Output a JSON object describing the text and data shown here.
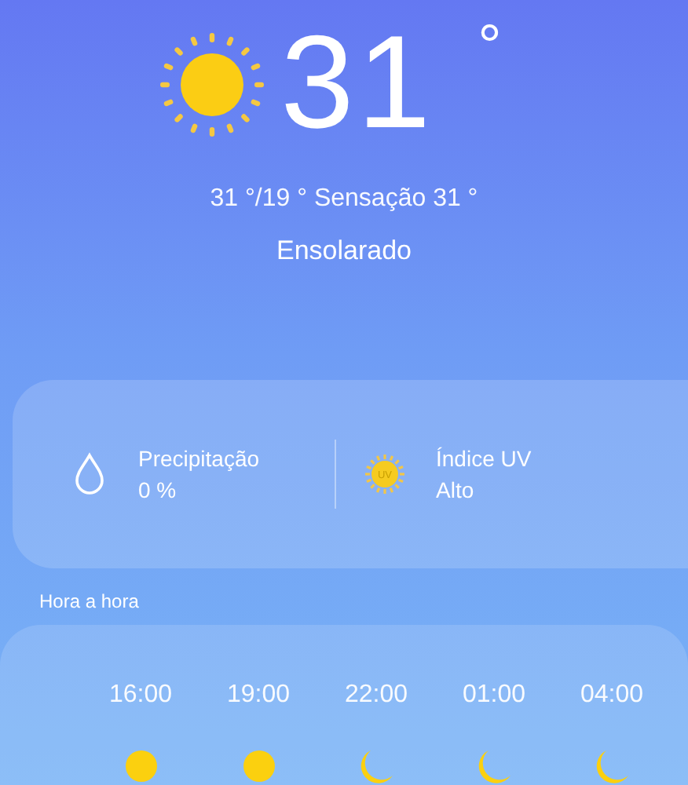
{
  "current": {
    "temperature": "31",
    "degree": "°",
    "range": "31 °/19 ° Sensação 31 °",
    "condition": "Ensolarado"
  },
  "details": [
    {
      "kind": "drop",
      "label": "Precipitação",
      "value": "0 %"
    },
    {
      "kind": "uv",
      "label": "Índice UV",
      "value": "Alto",
      "badge": "UV"
    }
  ],
  "hourly": {
    "title": "Hora a hora",
    "items": [
      {
        "time": "16:00",
        "kind": "sun"
      },
      {
        "time": "19:00",
        "kind": "sun"
      },
      {
        "time": "22:00",
        "kind": "moon"
      },
      {
        "time": "01:00",
        "kind": "moon"
      },
      {
        "time": "04:00",
        "kind": "moon"
      }
    ]
  }
}
